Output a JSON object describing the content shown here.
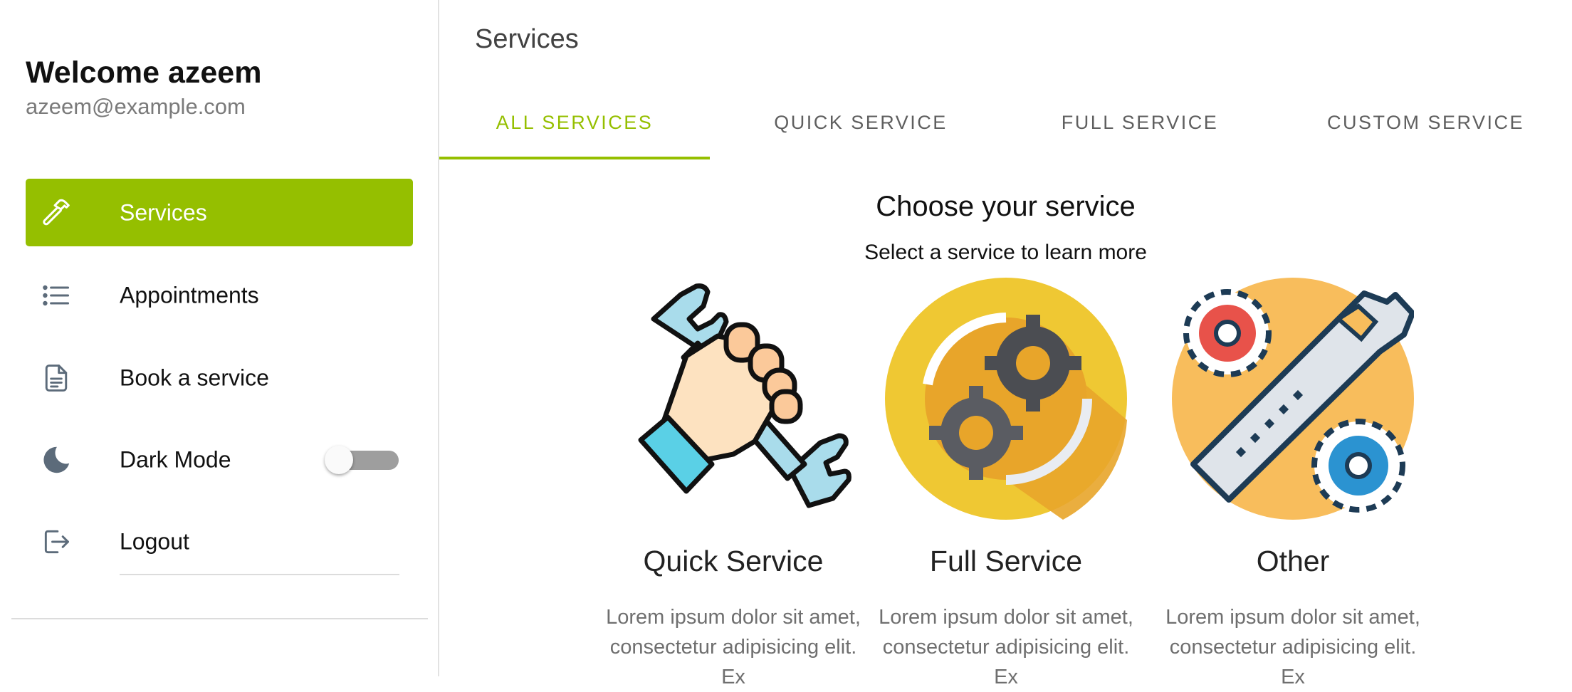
{
  "sidebar": {
    "welcome": "Welcome azeem",
    "email": "azeem@example.com",
    "items": [
      {
        "label": "Services",
        "icon": "hammer-icon",
        "active": true
      },
      {
        "label": "Appointments",
        "icon": "list-icon"
      },
      {
        "label": "Book a service",
        "icon": "document-icon"
      },
      {
        "label": "Dark Mode",
        "icon": "moon-icon",
        "toggle": false
      },
      {
        "label": "Logout",
        "icon": "logout-icon"
      }
    ]
  },
  "main": {
    "title": "Services",
    "tabs": [
      {
        "label": "ALL SERVICES",
        "active": true
      },
      {
        "label": "QUICK SERVICE"
      },
      {
        "label": "FULL SERVICE"
      },
      {
        "label": "CUSTOM SERVICE"
      }
    ],
    "heading": "Choose your service",
    "subheading": "Select a service to learn more",
    "cards": [
      {
        "title": "Quick Service",
        "text": "Lorem ipsum dolor sit amet, consectetur adipisicing elit. Ex",
        "icon": "wrench-fist-icon"
      },
      {
        "title": "Full Service",
        "text": "Lorem ipsum dolor sit amet, consectetur adipisicing elit. Ex",
        "icon": "gears-icon"
      },
      {
        "title": "Other",
        "text": "Lorem ipsum dolor sit amet, consectetur adipisicing elit. Ex",
        "icon": "wrench-gears-icon"
      }
    ]
  },
  "colors": {
    "accent": "#95bf00",
    "icon_gray": "#5c6b7a"
  }
}
